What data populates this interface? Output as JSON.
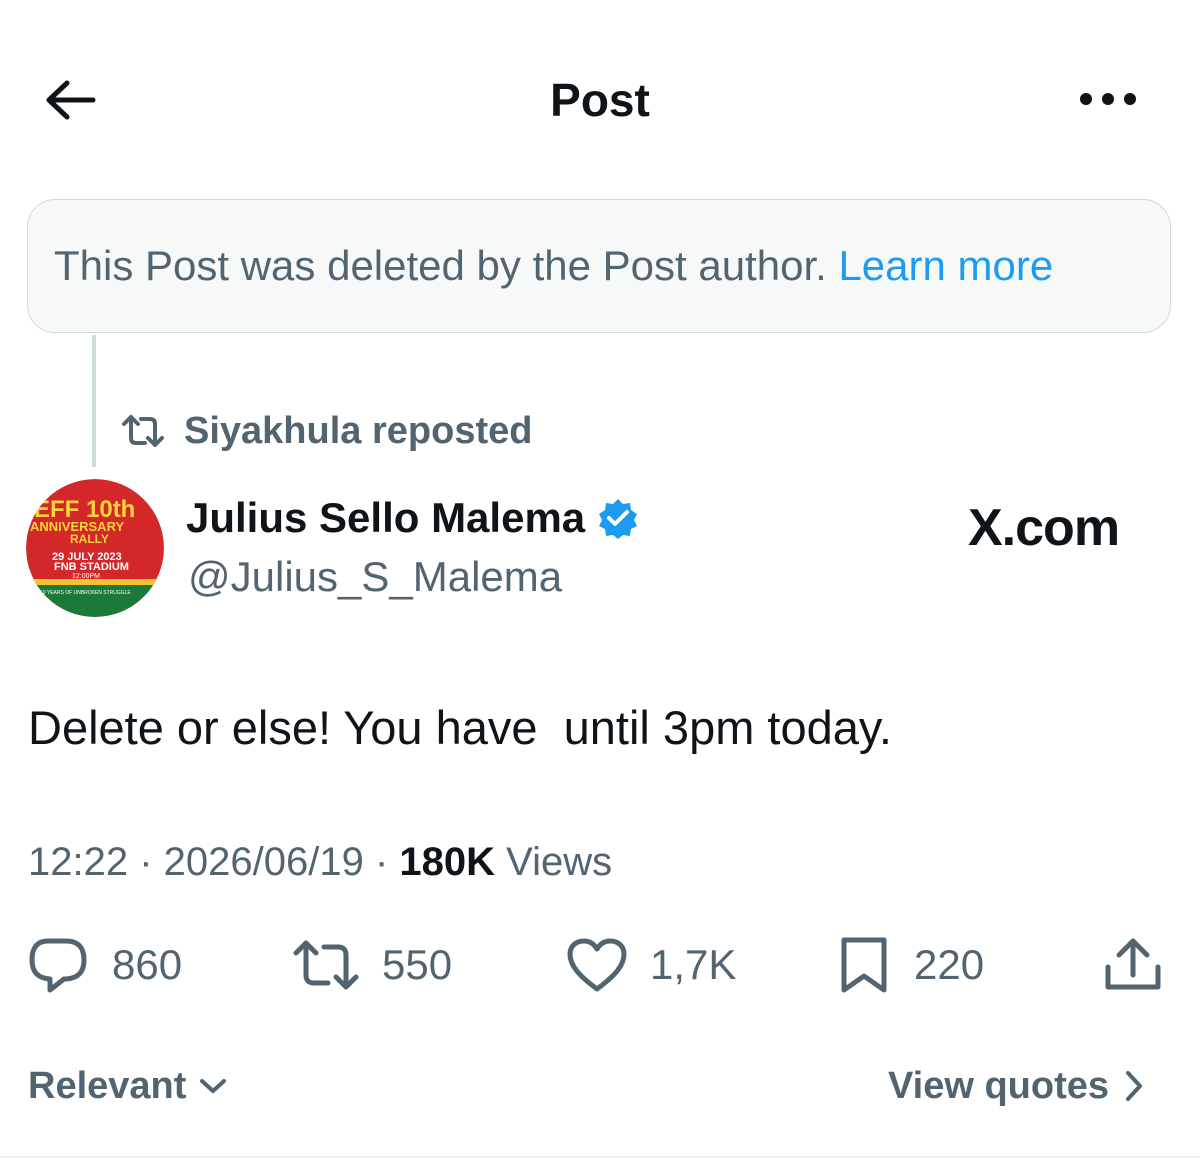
{
  "header": {
    "title": "Post",
    "back_icon": "arrow-left-icon",
    "more_icon": "more-horizontal-icon"
  },
  "deleted_notice": {
    "text": "This Post was deleted by the Post author.",
    "link": "Learn more"
  },
  "repost": {
    "icon": "repost-icon",
    "label": "Siyakhula reposted"
  },
  "author": {
    "name": "Julius Sello Malema",
    "handle": "@Julius_S_Malema",
    "verified_icon": "verified-badge-icon",
    "avatar": {
      "line1": "EFF 10th",
      "line2": "ANNIVERSARY",
      "line3": "RALLY",
      "line4": "29 JULY 2023",
      "line5": "FNB STADIUM",
      "line6": "12:00PM",
      "line7": "10 YEARS OF UNBROKEN STRUGGLE"
    }
  },
  "watermark": "X.com",
  "post": {
    "text": "Delete or else! You have  until 3pm today.",
    "time": "12:22",
    "date": "2026/06/19",
    "views_count": "180K",
    "views_label": "Views",
    "separator": " · "
  },
  "actions": {
    "replies": "860",
    "reposts": "550",
    "likes": "1,7K",
    "bookmarks": "220"
  },
  "footer": {
    "sort_label": "Relevant",
    "view_quotes": "View quotes"
  },
  "colors": {
    "text_primary": "#0f1419",
    "text_secondary": "#536471",
    "link": "#1d9bf0",
    "verified": "#1d9bf0",
    "notice_bg": "#f7f9f9",
    "border": "#cfd9de"
  }
}
